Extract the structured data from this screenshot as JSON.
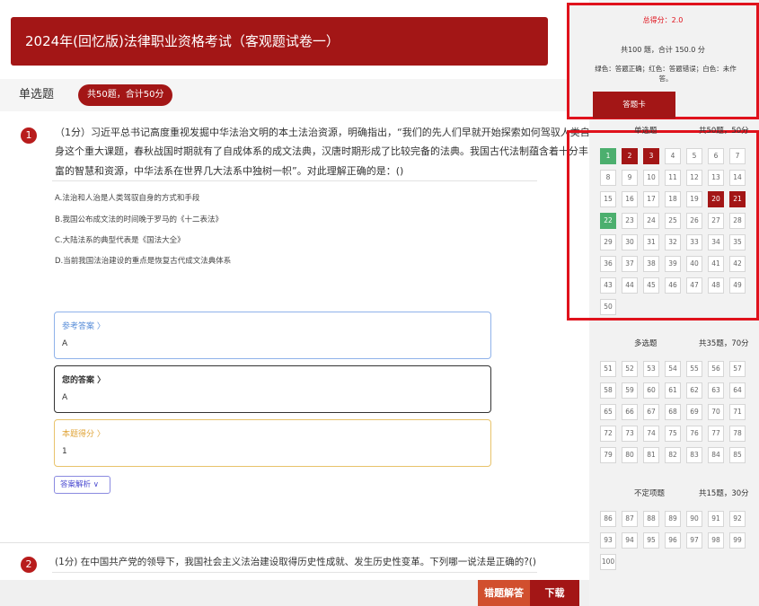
{
  "exam_title": "2024年(回忆版)法律职业资格考试（客观题试卷一）",
  "section": {
    "label": "单选题",
    "badge": "共50题，合计50分"
  },
  "question1": {
    "number": "1",
    "text_lines": [
      "（1分）习近平总书记高度重视发掘中华法治文明的本土法治资源，明确指出，“我们的先人们早就开始探索如何驾驭人类自",
      "身这个重大课题，春秋战国时期就有了自成体系的成文法典，汉唐时期形成了比较完备的法典。我国古代法制蕴含着十分丰",
      "富的智慧和资源，中华法系在世界几大法系中独树一帜”。对此理解正确的是：()"
    ],
    "options": [
      "A.法治和人治是人类驾驭自身的方式和手段",
      "B.我国公布成文法的时间晚于罗马的《十二表法》",
      "C.大陆法系的典型代表是《国法大全》",
      "D.当前我国法治建设的重点是恢复古代成文法典体系"
    ],
    "reference": {
      "title": "参考答案  〉",
      "value": "A",
      "color": "#5b8fd9"
    },
    "yours": {
      "title": "您的答案  〉",
      "value": "A",
      "color": "#333333"
    },
    "score": {
      "title": "本题得分  〉",
      "value": "1",
      "color": "#e0a53a"
    },
    "analysis_label": "答案解析  ∨"
  },
  "question2": {
    "number": "2",
    "text": "(1分) 在中国共产党的领导下，我国社会主义法治建设取得历史性成就、发生历史性变革。下列哪一说法是正确的?()"
  },
  "buttons": {
    "error": "错题解答",
    "download": "下载"
  },
  "summary": {
    "total_score": "总得分：2.0",
    "total_count": "共100 题，合计 150.0 分",
    "legend": "绿色：答题正确；红色：答题错误；白色：未作答。",
    "card_button": "答题卡"
  },
  "answer_card": [
    {
      "name": "单选题",
      "count": "共50题，50分",
      "start": 1,
      "end": 50,
      "correct": [
        1,
        22
      ],
      "wrong": [
        2,
        3,
        20,
        21
      ]
    },
    {
      "name": "多选题",
      "count": "共35题，70分",
      "start": 51,
      "end": 85,
      "correct": [],
      "wrong": []
    },
    {
      "name": "不定项题",
      "count": "共15题，30分",
      "start": 86,
      "end": 100,
      "correct": [],
      "wrong": []
    }
  ],
  "colors": {
    "brand": "#a31616",
    "correct": "#4caf6e",
    "highlight": "#e0121c"
  }
}
